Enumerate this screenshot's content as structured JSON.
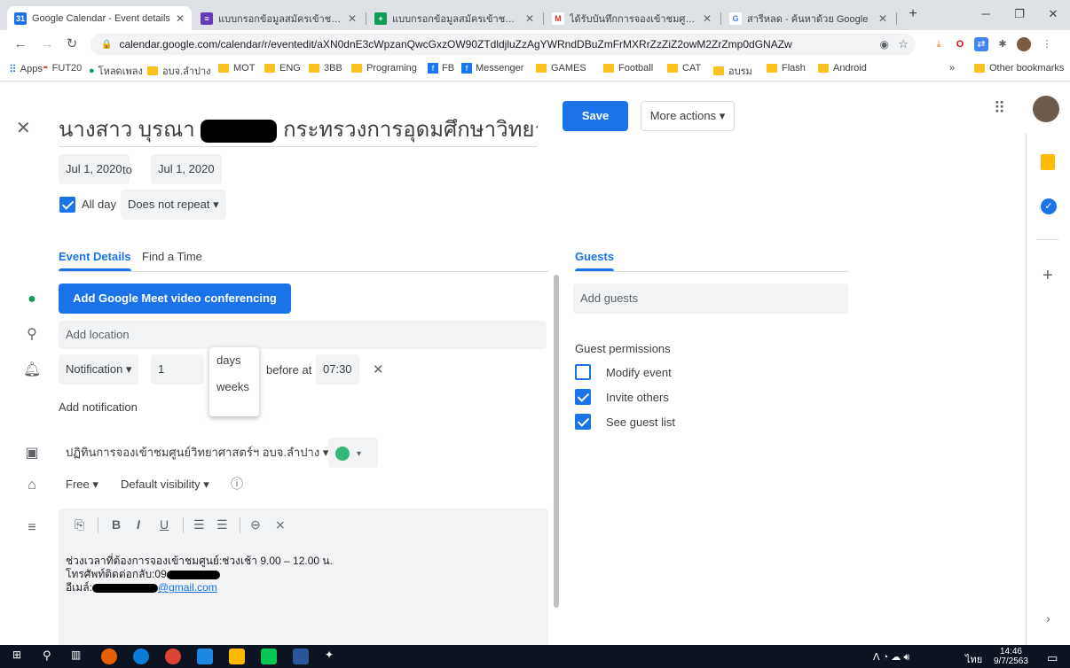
{
  "browser": {
    "tabs": [
      {
        "title": "Google Calendar - Event details",
        "fav": "31",
        "fav_color": "#1a73e8",
        "active": true
      },
      {
        "title": "แบบกรอกข้อมูลสมัครเข้าชมศูนย์วิทยาฯ",
        "fav": "≡",
        "fav_color": "#673ab7",
        "active": false
      },
      {
        "title": "แบบกรอกข้อมูลสมัครเข้าชมศูนย์วิทยาฯ",
        "fav": "+",
        "fav_color": "#0f9d58",
        "active": false
      },
      {
        "title": "ได้รับบันทึกการจองเข้าชมศูนย์วิทยาศาสตร์",
        "fav": "M",
        "fav_color": "#ffffff",
        "active": false
      },
      {
        "title": "สารีหลด - ค้นหาด้วย Google",
        "fav": "G",
        "fav_color": "#ffffff",
        "active": false
      }
    ],
    "new_tab": "+",
    "url": "calendar.google.com/calendar/r/eventedit/aXN0dnE3cWpzanQwcGxzOW90ZTdldjluZzAgYWRndDBuZmFrMXRrZzZiZ2owM2ZrZmp0dGNAZw",
    "bookmarks": [
      {
        "label": "Apps",
        "kind": "apps"
      },
      {
        "label": "FUT20",
        "kind": "site"
      },
      {
        "label": "โหลดเพลง",
        "kind": "site"
      },
      {
        "label": "อบจ.ลำปาง",
        "kind": "folder"
      },
      {
        "label": "MOT",
        "kind": "folder"
      },
      {
        "label": "ENG",
        "kind": "folder"
      },
      {
        "label": "3BB",
        "kind": "folder"
      },
      {
        "label": "Programing",
        "kind": "folder"
      },
      {
        "label": "FB",
        "kind": "fb"
      },
      {
        "label": "Messenger",
        "kind": "fb"
      },
      {
        "label": "GAMES",
        "kind": "folder"
      },
      {
        "label": "Football",
        "kind": "folder"
      },
      {
        "label": "CAT",
        "kind": "folder"
      },
      {
        "label": "อบรม",
        "kind": "folder"
      },
      {
        "label": "Flash",
        "kind": "folder"
      },
      {
        "label": "Android",
        "kind": "folder"
      }
    ],
    "bookmarks_overflow": "»",
    "other_bookmarks": "Other bookmarks"
  },
  "event": {
    "title_start": "นางสาว บุรณา",
    "title_end": "กระทรวงการอุดมศึกษาวิทยา",
    "save_label": "Save",
    "more_actions_label": "More actions ▾",
    "start_date": "Jul 1, 2020",
    "to_label": "to",
    "end_date": "Jul 1, 2020",
    "all_day_label": "All day",
    "repeat_label": "Does not repeat ▾",
    "tab_event_details": "Event Details",
    "tab_find_time": "Find a Time",
    "meet_label": "Add Google Meet video conferencing",
    "location_placeholder": "Add location",
    "notification_type": "Notification ▾",
    "notification_value": "1",
    "units_options": [
      "days",
      "weeks"
    ],
    "before_at": "before at",
    "time": "07:30",
    "add_notification": "Add notification",
    "calendar_name": "ปฏิทินการจองเข้าชมศูนย์วิทยาศาสตร์ฯ อบจ.ลำปาง ▾",
    "event_color": "#33b679",
    "availability": "Free ▾",
    "visibility": "Default visibility ▾",
    "description_line1": "ช่วงเวลาที่ต้องการจองเข้าชมศูนย์:ช่วงเช้า 9.00 – 12.00 น.",
    "description_line2": "โทรศัพท์ติดต่อกลับ:09",
    "description_line3_prefix": "อีเมล์:",
    "description_email_suffix": "@gmail.com"
  },
  "guests": {
    "tab_label": "Guests",
    "add_placeholder": "Add guests",
    "permissions_title": "Guest permissions",
    "permissions": [
      {
        "label": "Modify event",
        "checked": false
      },
      {
        "label": "Invite others",
        "checked": true
      },
      {
        "label": "See guest list",
        "checked": true
      }
    ]
  },
  "taskbar": {
    "lang": "ไทย",
    "time": "14:46",
    "date": "9/7/2563"
  }
}
